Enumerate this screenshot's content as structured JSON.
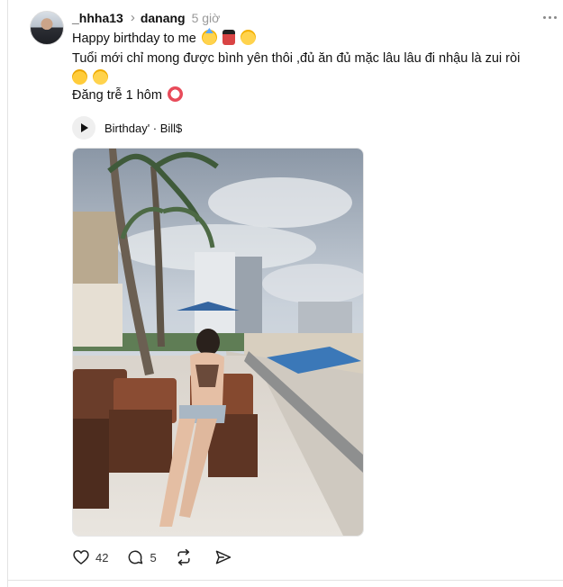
{
  "post": {
    "username": "_hhha13",
    "topic": "danang",
    "time": "5 giờ",
    "lines": [
      "Happy birthday to me",
      "Tuổi mới chỉ mong được bình yên thôi ,đủ ăn đủ mặc lâu lâu đi nhậu là zui ròi",
      "",
      "Đăng trễ 1 hôm"
    ],
    "music": {
      "track": "Birthday' · Bill$"
    },
    "stats": {
      "likes": "42",
      "comments": "5"
    }
  },
  "icons": [
    "more-icon",
    "play-icon",
    "heart-icon",
    "comment-icon",
    "repost-icon",
    "share-icon"
  ],
  "colors": {
    "text": "#111111",
    "muted": "#9a9a9a",
    "divider": "#e3e3e3"
  }
}
